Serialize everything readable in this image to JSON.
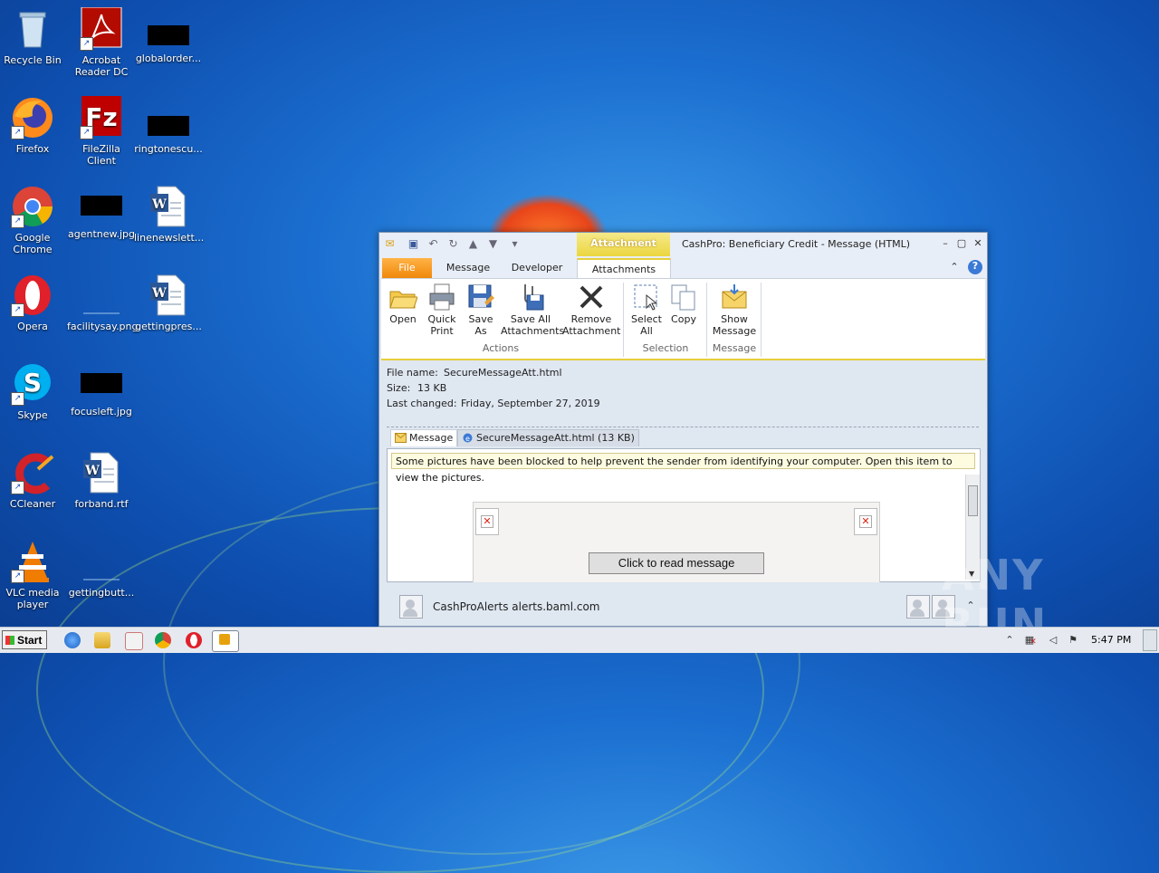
{
  "desktop": {
    "icons": [
      {
        "label": "Recycle Bin"
      },
      {
        "label": "Acrobat Reader DC"
      },
      {
        "label": "globalorder..."
      },
      {
        "label": "Firefox"
      },
      {
        "label": "FileZilla Client"
      },
      {
        "label": "ringtonescu..."
      },
      {
        "label": "Google Chrome"
      },
      {
        "label": "agentnew.jpg"
      },
      {
        "label": "linenewslett..."
      },
      {
        "label": "Opera"
      },
      {
        "label": "facilitysay.png"
      },
      {
        "label": "gettingpres..."
      },
      {
        "label": "Skype"
      },
      {
        "label": "focusleft.jpg"
      },
      {
        "label": "CCleaner"
      },
      {
        "label": "forband.rtf"
      },
      {
        "label": "VLC media player"
      },
      {
        "label": "gettingbutt..."
      }
    ]
  },
  "window": {
    "context_tools": "Attachment Tools",
    "title": "CashPro: Beneficiary Credit -  Message (HTML)",
    "tabs": {
      "file": "File",
      "message": "Message",
      "developer": "Developer",
      "attachments": "Attachments"
    },
    "ribbon": {
      "open": "Open",
      "quick_print": "Quick\nPrint",
      "save_as": "Save\nAs",
      "save_all": "Save All\nAttachments",
      "remove": "Remove\nAttachment",
      "actions_group": "Actions",
      "select_all": "Select\nAll",
      "copy": "Copy",
      "selection_group": "Selection",
      "show_message": "Show\nMessage",
      "message_group": "Message"
    },
    "details": {
      "file_name_label": "File name:",
      "file_name": "SecureMessageAtt.html",
      "size_label": "Size:",
      "size": "13 KB",
      "last_changed_label": "Last changed:",
      "last_changed": "Friday, September 27, 2019"
    },
    "message_tabs": {
      "message": "Message",
      "attachment": "SecureMessageAtt.html (13 KB)"
    },
    "blocked_notice": "Some pictures have been blocked to help prevent the sender from identifying your computer. Open this item to view the pictures.",
    "read_button": "Click to read message",
    "sender": "CashProAlerts alerts.baml.com"
  },
  "taskbar": {
    "start": "Start",
    "clock": "5:47 PM"
  },
  "watermark": "ANY RUN",
  "colors": {
    "file_tab": "#f0880a",
    "context_tools": "#ecd640",
    "desktop_bg": "#1b6fd0"
  }
}
